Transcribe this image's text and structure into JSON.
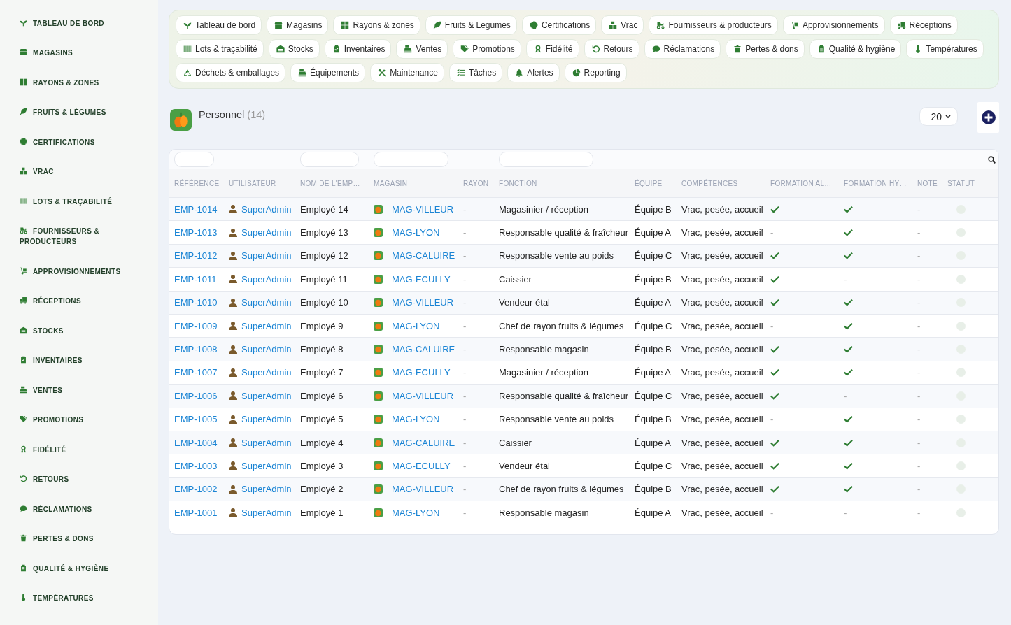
{
  "sidebar": {
    "items": [
      {
        "label": "TABLEAU DE BORD"
      },
      {
        "label": "MAGASINS"
      },
      {
        "label": "RAYONS & ZONES"
      },
      {
        "label": "FRUITS & LÉGUMES"
      },
      {
        "label": "CERTIFICATIONS"
      },
      {
        "label": "VRAC"
      },
      {
        "label": "LOTS & TRAÇABILITÉ"
      },
      {
        "label": "FOURNISSEURS & PRODUCTEURS"
      },
      {
        "label": "APPROVISIONNEMENTS"
      },
      {
        "label": "RÉCEPTIONS"
      },
      {
        "label": "STOCKS"
      },
      {
        "label": "INVENTAIRES"
      },
      {
        "label": "VENTES"
      },
      {
        "label": "PROMOTIONS"
      },
      {
        "label": "FIDÉLITÉ"
      },
      {
        "label": "RETOURS"
      },
      {
        "label": "RÉCLAMATIONS"
      },
      {
        "label": "PERTES & DONS"
      },
      {
        "label": "QUALITÉ & HYGIÈNE"
      },
      {
        "label": "TEMPÉRATURES"
      }
    ]
  },
  "nav": {
    "chips": [
      {
        "label": "Tableau de bord"
      },
      {
        "label": "Magasins"
      },
      {
        "label": "Rayons & zones"
      },
      {
        "label": "Fruits & Légumes"
      },
      {
        "label": "Certifications"
      },
      {
        "label": "Vrac"
      },
      {
        "label": "Fournisseurs & producteurs"
      },
      {
        "label": "Approvisionnements"
      },
      {
        "label": "Réceptions"
      },
      {
        "label": "Lots & traçabilité"
      },
      {
        "label": "Stocks"
      },
      {
        "label": "Inventaires"
      },
      {
        "label": "Ventes"
      },
      {
        "label": "Promotions"
      },
      {
        "label": "Fidélité"
      },
      {
        "label": "Retours"
      },
      {
        "label": "Réclamations"
      },
      {
        "label": "Pertes & dons"
      },
      {
        "label": "Qualité & hygiène"
      },
      {
        "label": "Températures"
      },
      {
        "label": "Déchets & emballages"
      },
      {
        "label": "Équipements"
      },
      {
        "label": "Maintenance"
      },
      {
        "label": "Tâches"
      },
      {
        "label": "Alertes"
      },
      {
        "label": "Reporting"
      }
    ]
  },
  "header": {
    "title": "Personnel",
    "count": "(14)",
    "page_size": "20"
  },
  "table": {
    "columns": [
      {
        "label": "RÉFÉRENCE",
        "filter": true
      },
      {
        "label": "UTILISATEUR",
        "filter": false
      },
      {
        "label": "NOM DE L'EMP…",
        "filter": true
      },
      {
        "label": "MAGASIN",
        "filter": true
      },
      {
        "label": "RAYON",
        "filter": false
      },
      {
        "label": "FONCTION",
        "filter": true
      },
      {
        "label": "ÉQUIPE",
        "filter": false
      },
      {
        "label": "COMPÉTENCES",
        "filter": false
      },
      {
        "label": "FORMATION AL…",
        "filter": false
      },
      {
        "label": "FORMATION HY…",
        "filter": false
      },
      {
        "label": "NOTE",
        "filter": false
      },
      {
        "label": "STATUT",
        "filter": false
      }
    ],
    "rows": [
      {
        "reference": "EMP-1014",
        "user": "SuperAdmin",
        "name": "Employé 14",
        "store": "MAG-VILLEUR",
        "rayon": "-",
        "function": "Magasinier / réception",
        "team": "Équipe B",
        "skills": "Vrac, pesée, accueil",
        "formation_al": {
          "checked": true
        },
        "formation_hy": {
          "checked": true
        },
        "note": "-"
      },
      {
        "reference": "EMP-1013",
        "user": "SuperAdmin",
        "name": "Employé 13",
        "store": "MAG-LYON",
        "rayon": "-",
        "function": "Responsable qualité & fraîcheur",
        "team": "Équipe A",
        "skills": "Vrac, pesée, accueil",
        "formation_al": {
          "checked": false,
          "text": "-"
        },
        "formation_hy": {
          "checked": true
        },
        "note": "-"
      },
      {
        "reference": "EMP-1012",
        "user": "SuperAdmin",
        "name": "Employé 12",
        "store": "MAG-CALUIRE",
        "rayon": "-",
        "function": "Responsable vente au poids",
        "team": "Équipe C",
        "skills": "Vrac, pesée, accueil",
        "formation_al": {
          "checked": true
        },
        "formation_hy": {
          "checked": true
        },
        "note": "-"
      },
      {
        "reference": "EMP-1011",
        "user": "SuperAdmin",
        "name": "Employé 11",
        "store": "MAG-ECULLY",
        "rayon": "-",
        "function": "Caissier",
        "team": "Équipe B",
        "skills": "Vrac, pesée, accueil",
        "formation_al": {
          "checked": true
        },
        "formation_hy": {
          "checked": false,
          "text": "-"
        },
        "note": "-"
      },
      {
        "reference": "EMP-1010",
        "user": "SuperAdmin",
        "name": "Employé 10",
        "store": "MAG-VILLEUR",
        "rayon": "-",
        "function": "Vendeur étal",
        "team": "Équipe A",
        "skills": "Vrac, pesée, accueil",
        "formation_al": {
          "checked": true
        },
        "formation_hy": {
          "checked": true
        },
        "note": "-"
      },
      {
        "reference": "EMP-1009",
        "user": "SuperAdmin",
        "name": "Employé 9",
        "store": "MAG-LYON",
        "rayon": "-",
        "function": "Chef de rayon fruits & légumes",
        "team": "Équipe C",
        "skills": "Vrac, pesée, accueil",
        "formation_al": {
          "checked": false,
          "text": "-"
        },
        "formation_hy": {
          "checked": true
        },
        "note": "-"
      },
      {
        "reference": "EMP-1008",
        "user": "SuperAdmin",
        "name": "Employé 8",
        "store": "MAG-CALUIRE",
        "rayon": "-",
        "function": "Responsable magasin",
        "team": "Équipe B",
        "skills": "Vrac, pesée, accueil",
        "formation_al": {
          "checked": true
        },
        "formation_hy": {
          "checked": true
        },
        "note": "-"
      },
      {
        "reference": "EMP-1007",
        "user": "SuperAdmin",
        "name": "Employé 7",
        "store": "MAG-ECULLY",
        "rayon": "-",
        "function": "Magasinier / réception",
        "team": "Équipe A",
        "skills": "Vrac, pesée, accueil",
        "formation_al": {
          "checked": true
        },
        "formation_hy": {
          "checked": true
        },
        "note": "-"
      },
      {
        "reference": "EMP-1006",
        "user": "SuperAdmin",
        "name": "Employé 6",
        "store": "MAG-VILLEUR",
        "rayon": "-",
        "function": "Responsable qualité & fraîcheur",
        "team": "Équipe C",
        "skills": "Vrac, pesée, accueil",
        "formation_al": {
          "checked": true
        },
        "formation_hy": {
          "checked": false,
          "text": "-"
        },
        "note": "-"
      },
      {
        "reference": "EMP-1005",
        "user": "SuperAdmin",
        "name": "Employé 5",
        "store": "MAG-LYON",
        "rayon": "-",
        "function": "Responsable vente au poids",
        "team": "Équipe B",
        "skills": "Vrac, pesée, accueil",
        "formation_al": {
          "checked": false,
          "text": "-"
        },
        "formation_hy": {
          "checked": true
        },
        "note": "-"
      },
      {
        "reference": "EMP-1004",
        "user": "SuperAdmin",
        "name": "Employé 4",
        "store": "MAG-CALUIRE",
        "rayon": "-",
        "function": "Caissier",
        "team": "Équipe A",
        "skills": "Vrac, pesée, accueil",
        "formation_al": {
          "checked": true
        },
        "formation_hy": {
          "checked": true
        },
        "note": "-"
      },
      {
        "reference": "EMP-1003",
        "user": "SuperAdmin",
        "name": "Employé 3",
        "store": "MAG-ECULLY",
        "rayon": "-",
        "function": "Vendeur étal",
        "team": "Équipe C",
        "skills": "Vrac, pesée, accueil",
        "formation_al": {
          "checked": true
        },
        "formation_hy": {
          "checked": true
        },
        "note": "-"
      },
      {
        "reference": "EMP-1002",
        "user": "SuperAdmin",
        "name": "Employé 2",
        "store": "MAG-VILLEUR",
        "rayon": "-",
        "function": "Chef de rayon fruits & légumes",
        "team": "Équipe B",
        "skills": "Vrac, pesée, accueil",
        "formation_al": {
          "checked": true
        },
        "formation_hy": {
          "checked": true
        },
        "note": "-"
      },
      {
        "reference": "EMP-1001",
        "user": "SuperAdmin",
        "name": "Employé 1",
        "store": "MAG-LYON",
        "rayon": "-",
        "function": "Responsable magasin",
        "team": "Équipe A",
        "skills": "Vrac, pesée, accueil",
        "formation_al": {
          "checked": false,
          "text": "-"
        },
        "formation_hy": {
          "checked": false,
          "text": "-"
        },
        "note": "-"
      }
    ]
  }
}
